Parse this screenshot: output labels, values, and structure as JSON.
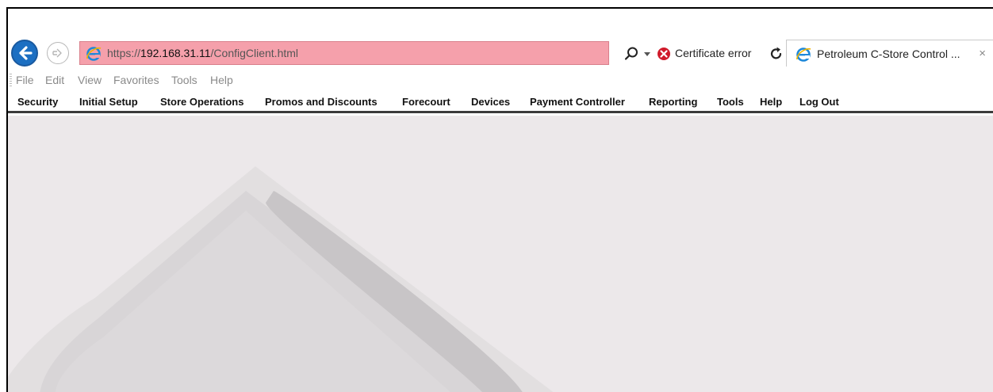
{
  "browser": {
    "address": {
      "scheme": "https://",
      "host": "192.168.31.11",
      "path": "/ConfigClient.html"
    },
    "certificate_status": "Certificate error",
    "tab_title": "Petroleum C-Store Control ...",
    "tab_close": "×",
    "menu": [
      "File",
      "Edit",
      "View",
      "Favorites",
      "Tools",
      "Help"
    ]
  },
  "app_nav": [
    "Security",
    "Initial Setup",
    "Store Operations",
    "Promos and Discounts",
    "Forecourt",
    "Devices",
    "Payment Controller",
    "Reporting",
    "Tools",
    "Help",
    "Log Out"
  ],
  "colors": {
    "address_error_bg": "#f5a0ab",
    "back_button": "#1c6fc2",
    "content_bg": "#ece8ea",
    "nav_border": "#3b3b3b"
  },
  "icons": [
    "back-arrow-icon",
    "forward-arrow-icon",
    "ie-logo-icon",
    "search-icon",
    "chevron-down-icon",
    "certificate-error-icon",
    "refresh-icon",
    "close-icon"
  ]
}
